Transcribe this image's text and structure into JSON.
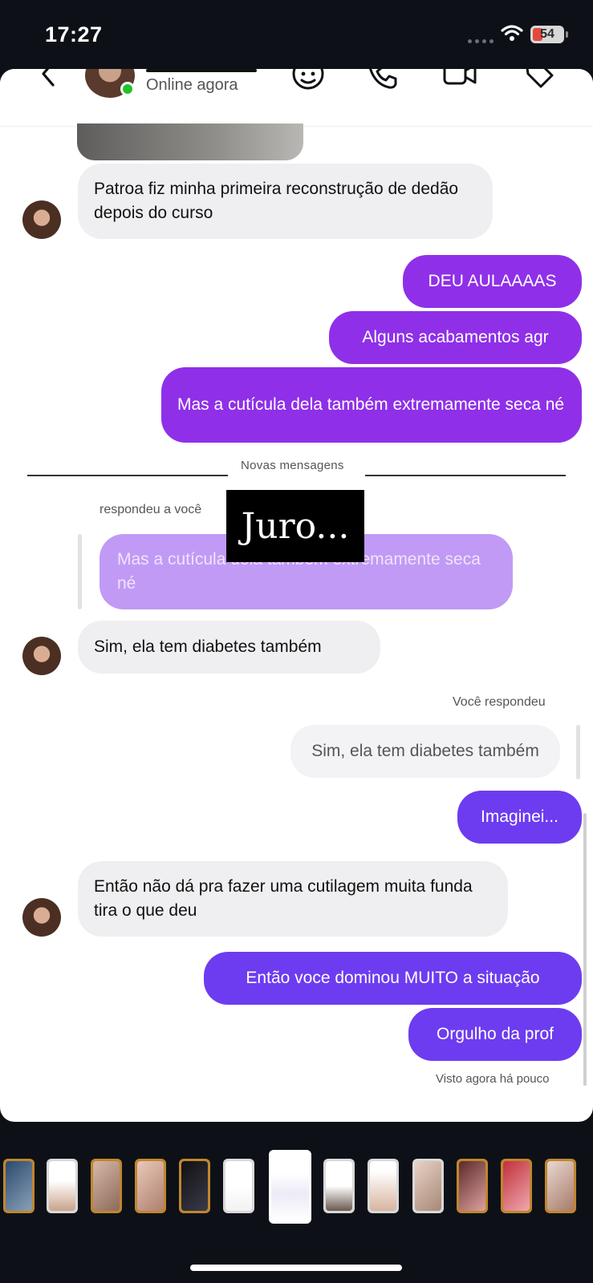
{
  "status_bar": {
    "time": "17:27",
    "battery": "54"
  },
  "header": {
    "contact_status": "Online agora",
    "icons": [
      "back-chevron-icon",
      "sticker-icon",
      "phone-icon",
      "video-camera-icon",
      "tag-icon"
    ]
  },
  "messages": {
    "m1": "Patroa fiz minha primeira reconstrução  de dedão depois do curso",
    "m2": "DEU AULAAAAS",
    "m3": "Alguns acabamentos agr",
    "m4": "Mas a cutícula dela também extremamente seca né",
    "divider": "Novas mensagens",
    "replied_to_you": "respondeu a você",
    "overlay_text": "Juro...",
    "quoted": "Mas a cutícula dela também extremamente seca né",
    "m5": "Sim, ela tem diabetes também",
    "you_replied": "Você respondeu",
    "reply_quote": "Sim, ela tem diabetes também",
    "m6": "Imaginei...",
    "m7": "Então não dá pra fazer uma cutilagem muita funda tira o que deu",
    "m8": "Então voce dominou MUITO a situação",
    "m9": "Orgulho da prof",
    "seen": "Visto agora há pouco"
  },
  "colors": {
    "outgoing_purple": "#8f30e8",
    "outgoing_violet": "#6d3cf0",
    "incoming": "#efeff1",
    "quote": "#c19af5",
    "online": "#20c32c"
  }
}
